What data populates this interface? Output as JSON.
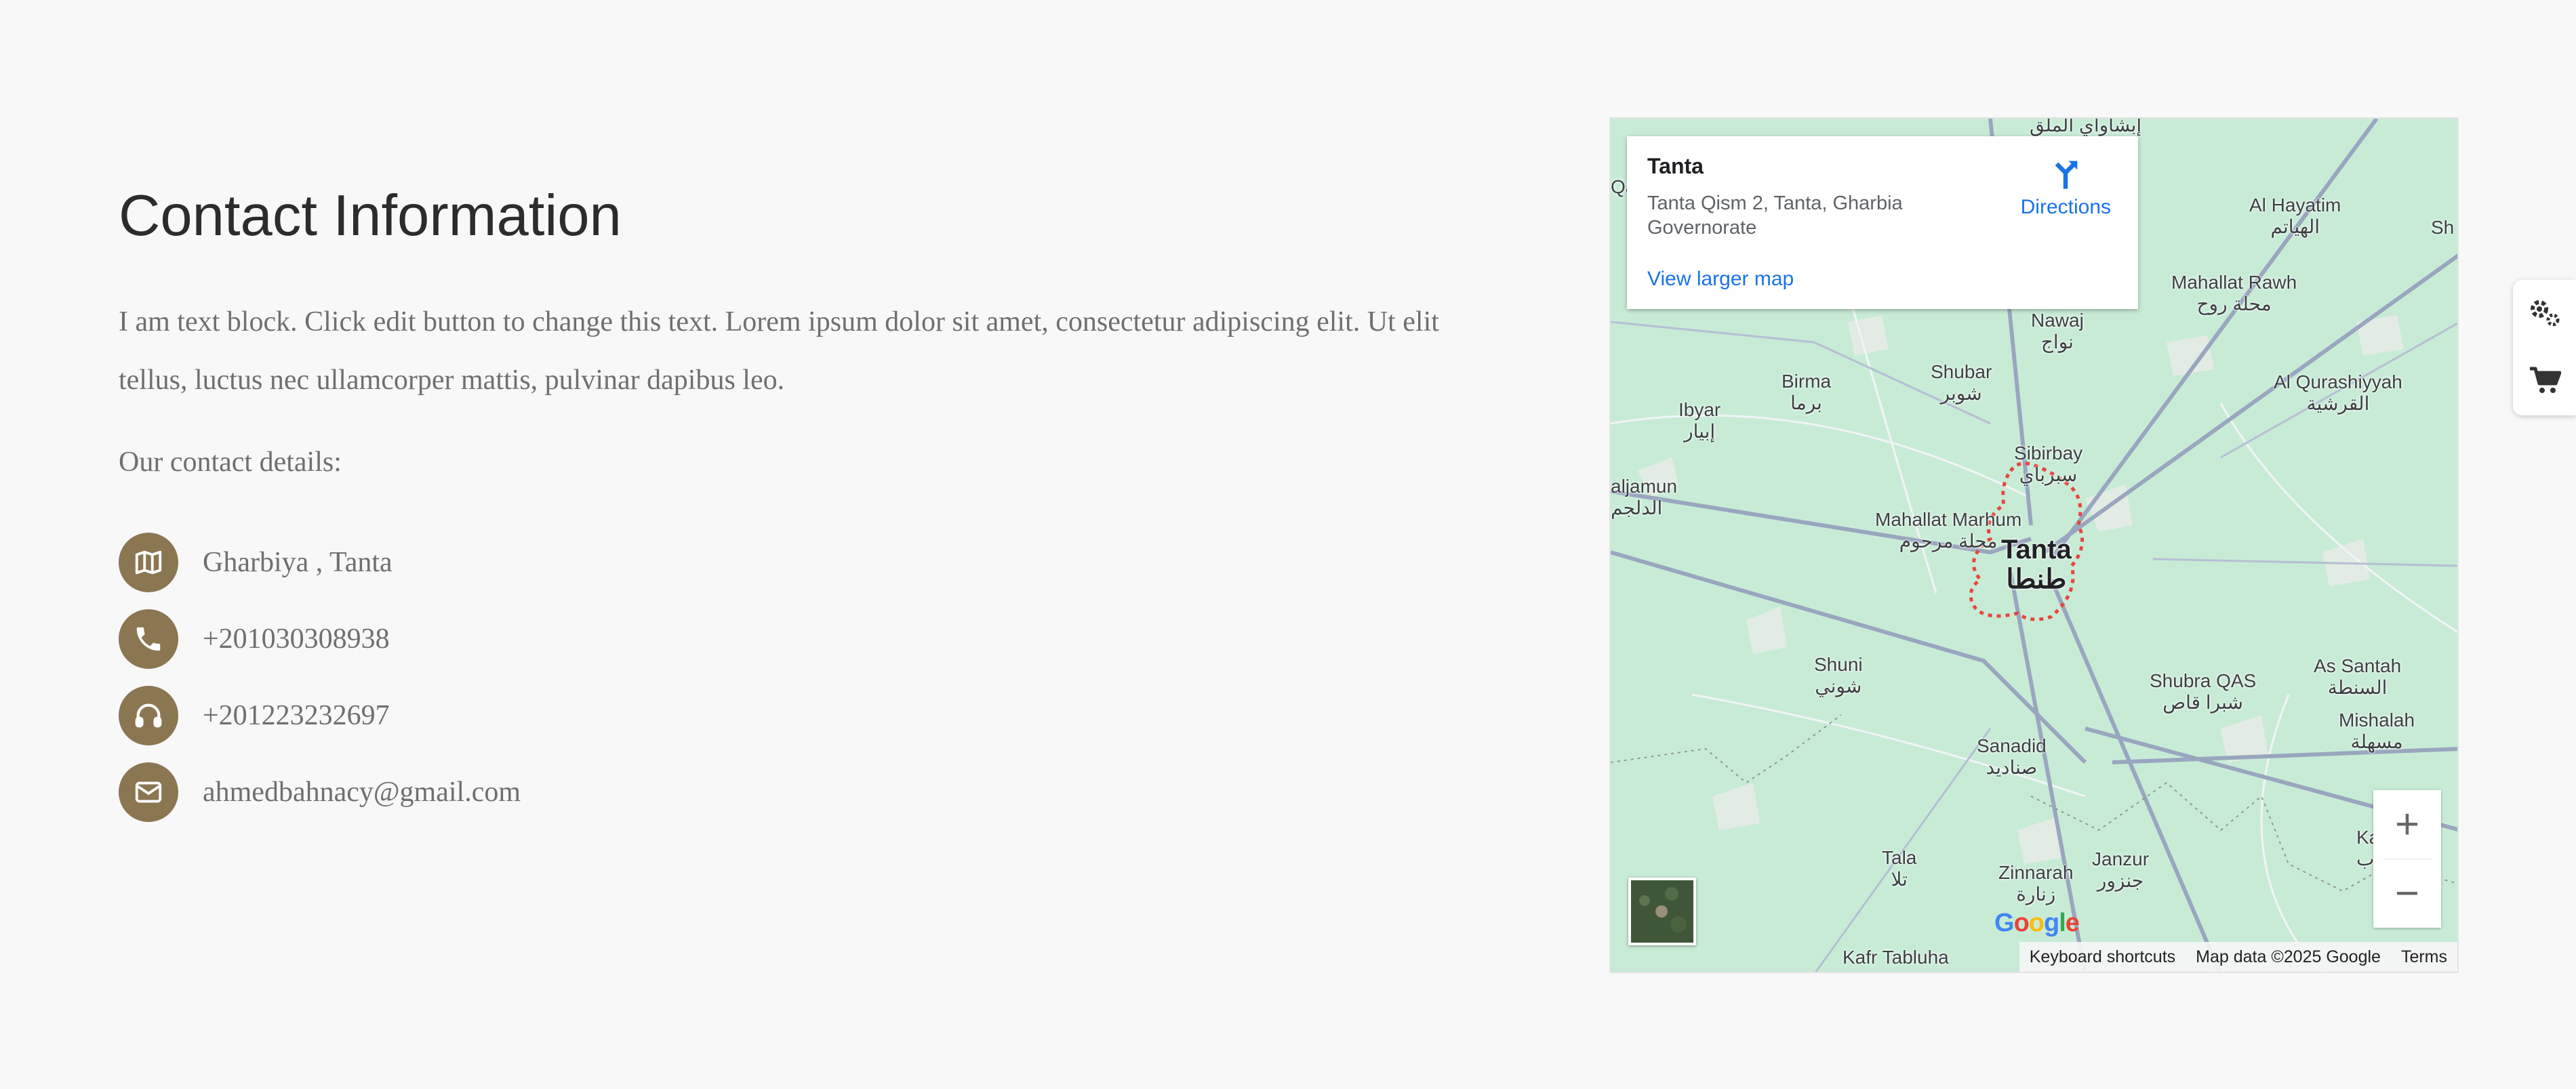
{
  "title": "Contact Information",
  "intro": "I am text block. Click edit button to change this text. Lorem ipsum dolor sit amet, consectetur adipiscing elit. Ut elit tellus, luctus nec ullamcorper mattis, pulvinar dapibus leo.",
  "subheading": "Our contact details:",
  "contacts": [
    {
      "icon": "map-icon",
      "text": "Gharbiya , Tanta"
    },
    {
      "icon": "phone-icon",
      "text": "+201030308938"
    },
    {
      "icon": "headphones-icon",
      "text": "+201223232697"
    },
    {
      "icon": "envelope-icon",
      "text": "ahmedbahnacy@gmail.com"
    }
  ],
  "map": {
    "card": {
      "place": "Tanta",
      "address": "Tanta Qism 2, Tanta, Gharbia Governorate",
      "view_larger": "View larger map",
      "directions": "Directions"
    },
    "labels": {
      "top": "إبشاواي الملق",
      "al_hayatim": "Al Hayatim",
      "al_hayatim_ar": "الهياتم",
      "mahallat_rawh": "Mahallat Rawh",
      "mahallat_rawh_ar": "محلة روح",
      "nawaj": "Nawaj",
      "nawaj_ar": "نواج",
      "birma": "Birma",
      "birma_ar": "برما",
      "shubar": "Shubar",
      "shubar_ar": "شوبر",
      "al_qurashiyyah": "Al Qurashiyyah",
      "al_qurashiyyah_ar": "القرشية",
      "ibyar": "Ibyar",
      "ibyar_ar": "إبيار",
      "sibirbay": "Sibirbay",
      "sibirbay_ar": "سبرباي",
      "aljamun": "aljamun",
      "aljamun_ar": "الدلجم",
      "mahallat_marhum": "Mahallat Marhum",
      "mahallat_marhum_ar": "محلة مرحوم",
      "tanta": "Tanta",
      "tanta_ar": "طنطا",
      "shuni": "Shuni",
      "shuni_ar": "شوني",
      "shubra_qas": "Shubra QAS",
      "shubra_qas_ar": "شبرا قاص",
      "as_santah": "As Santah",
      "as_santah_ar": "السنطة",
      "mishalah": "Mishalah",
      "mishalah_ar": "مسهلة",
      "sanadid": "Sanadid",
      "sanadid_ar": "صناديد",
      "tala": "Tala",
      "tala_ar": "تلا",
      "zinnarah": "Zinnarah",
      "zinnarah_ar": "زنارة",
      "janzur": "Janzur",
      "janzur_ar": "جنزور",
      "kafr_tabluha": "Kafr Tabluha",
      "edge_ka": "Ka",
      "edge_ab": "اب",
      "edge_qa": "Qa",
      "edge_sh": "Sh"
    },
    "zoom_in": "+",
    "zoom_out": "−",
    "logo": "Google",
    "attribution": {
      "shortcuts": "Keyboard shortcuts",
      "data": "Map data ©2025 Google",
      "terms": "Terms"
    }
  },
  "sidebar": [
    {
      "icon": "gears-icon"
    },
    {
      "icon": "cart-icon"
    }
  ],
  "colors": {
    "accent": "#8b7652",
    "text": "#6f6f6f",
    "heading": "#2c2c2c",
    "map_land": "#c8ebd6",
    "link": "#1a73e8"
  }
}
